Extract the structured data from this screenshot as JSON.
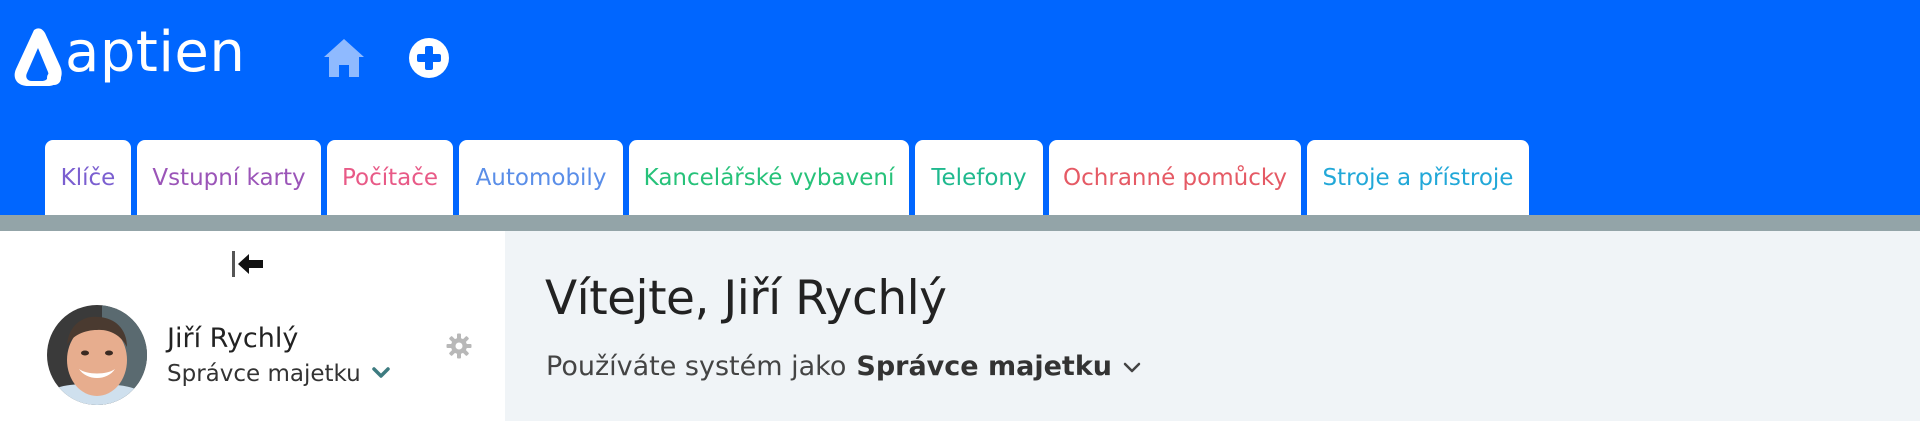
{
  "brand": {
    "name": "aptien"
  },
  "header": {
    "home_icon": "home-icon",
    "add_icon": "plus-circle-icon",
    "background": "#0066ff"
  },
  "tabs": [
    {
      "label": "Klíče",
      "color": "#7b5fd0"
    },
    {
      "label": "Vstupní karty",
      "color": "#9b55b8"
    },
    {
      "label": "Počítače",
      "color": "#e85a87"
    },
    {
      "label": "Automobily",
      "color": "#5a8ee8"
    },
    {
      "label": "Kancelářské vybavení",
      "color": "#27c27a"
    },
    {
      "label": "Telefony",
      "color": "#1fb98e"
    },
    {
      "label": "Ochranné pomůcky",
      "color": "#e55a65"
    },
    {
      "label": "Stroje a přístroje",
      "color": "#22a8d8"
    }
  ],
  "sidebar": {
    "collapse_icon": "collapse-left-icon",
    "user": {
      "name": "Jiří Rychlý",
      "role": "Správce majetku"
    },
    "settings_icon": "gear-icon"
  },
  "main": {
    "welcome": "Vítejte, Jiří Rychlý",
    "using_prefix": "Používáte systém jako",
    "role": "Správce majetku"
  }
}
